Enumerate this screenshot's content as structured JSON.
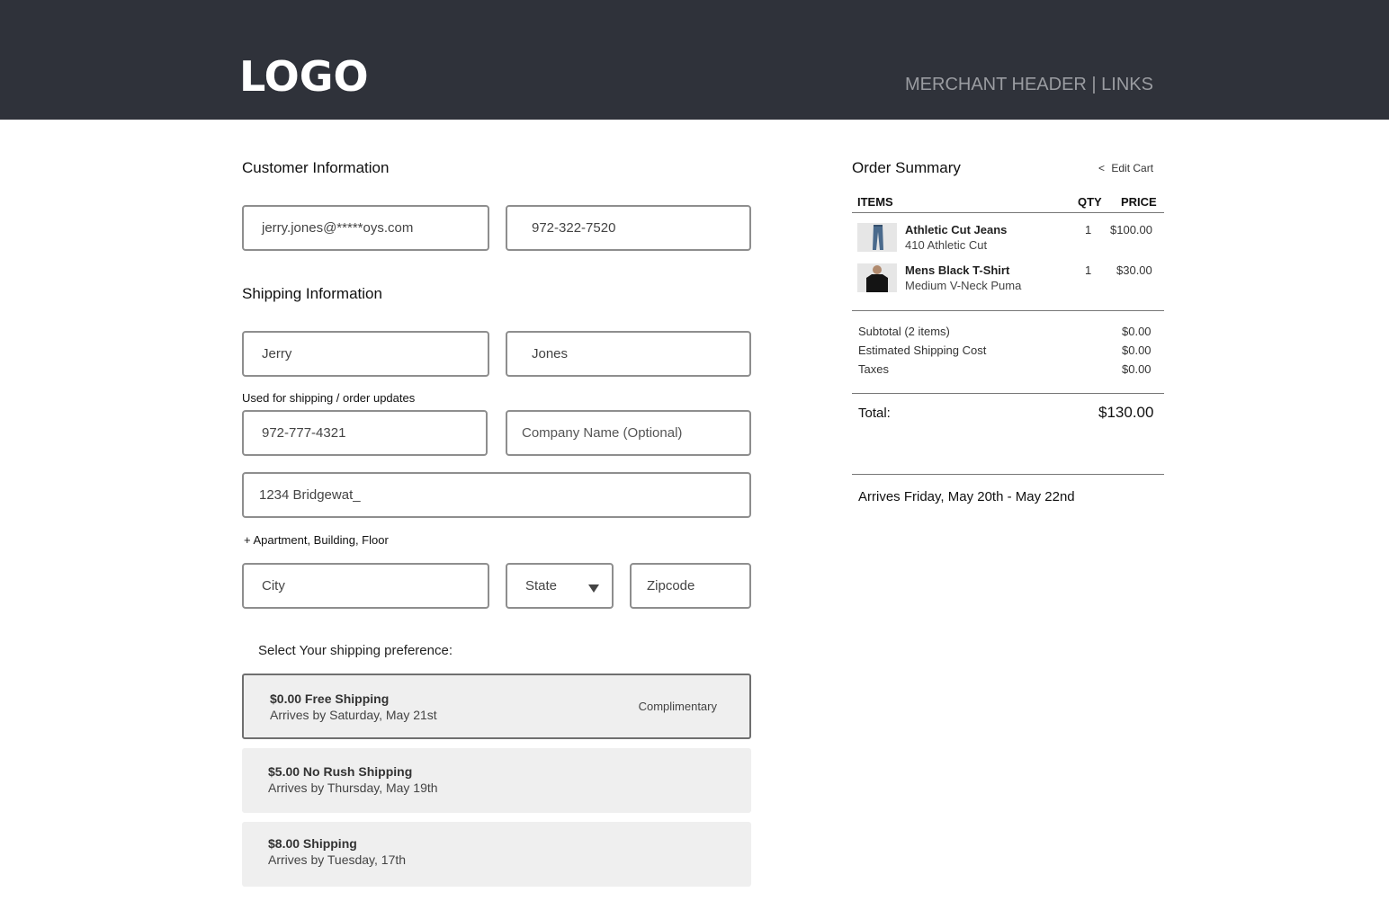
{
  "header": {
    "logo": "LOGO",
    "merchant_links": "MERCHANT HEADER | LINKS"
  },
  "customer": {
    "title": "Customer Information",
    "email": "jerry.jones@*****oys.com",
    "phone": "972-322-7520"
  },
  "shipping": {
    "title": "Shipping Information",
    "first_name": "Jerry",
    "last_name": "Jones",
    "phone_note": "Used for shipping / order updates",
    "phone": "972-777-4321",
    "company_placeholder": "Company Name (Optional)",
    "address": "1234 Bridgewat_",
    "add_apartment": "+ Apartment, Building, Floor",
    "city_placeholder": "City",
    "state_selected": "State",
    "zip_placeholder": "Zipcode"
  },
  "shipping_pref": {
    "title": "Select Your shipping preference:",
    "options": [
      {
        "title": "$0.00 Free Shipping",
        "subtitle": "Arrives by Saturday, May 21st",
        "tag": "Complimentary",
        "selected": true
      },
      {
        "title": "$5.00 No Rush Shipping",
        "subtitle": "Arrives by Thursday, May 19th",
        "tag": "",
        "selected": false
      },
      {
        "title": "$8.00 Shipping",
        "subtitle": "Arrives by Tuesday, 17th",
        "tag": "",
        "selected": false
      }
    ]
  },
  "summary": {
    "title": "Order Summary",
    "edit_cart_icon": "<",
    "edit_cart": "Edit Cart",
    "columns": {
      "items": "ITEMS",
      "qty": "QTY",
      "price": "PRICE"
    },
    "items": [
      {
        "name": "Athletic Cut Jeans",
        "variant": "410 Athletic Cut",
        "qty": "1",
        "price": "$100.00",
        "thumb_icon": "jeans-thumbnail"
      },
      {
        "name": "Mens Black T-Shirt",
        "variant": "Medium V-Neck Puma",
        "qty": "1",
        "price": "$30.00",
        "thumb_icon": "tshirt-thumbnail"
      }
    ],
    "lines": [
      {
        "label": "Subtotal (2 items)",
        "value": "$0.00"
      },
      {
        "label": "Estimated Shipping Cost",
        "value": "$0.00"
      },
      {
        "label": "Taxes",
        "value": "$0.00"
      }
    ],
    "total_label": "Total:",
    "total_value": "$130.00",
    "arrival": "Arrives Friday, May 20th - May 22nd"
  },
  "colors": {
    "header_bg": "#2f323a",
    "option_bg": "#efefef",
    "field_border": "#8e8e8e"
  }
}
